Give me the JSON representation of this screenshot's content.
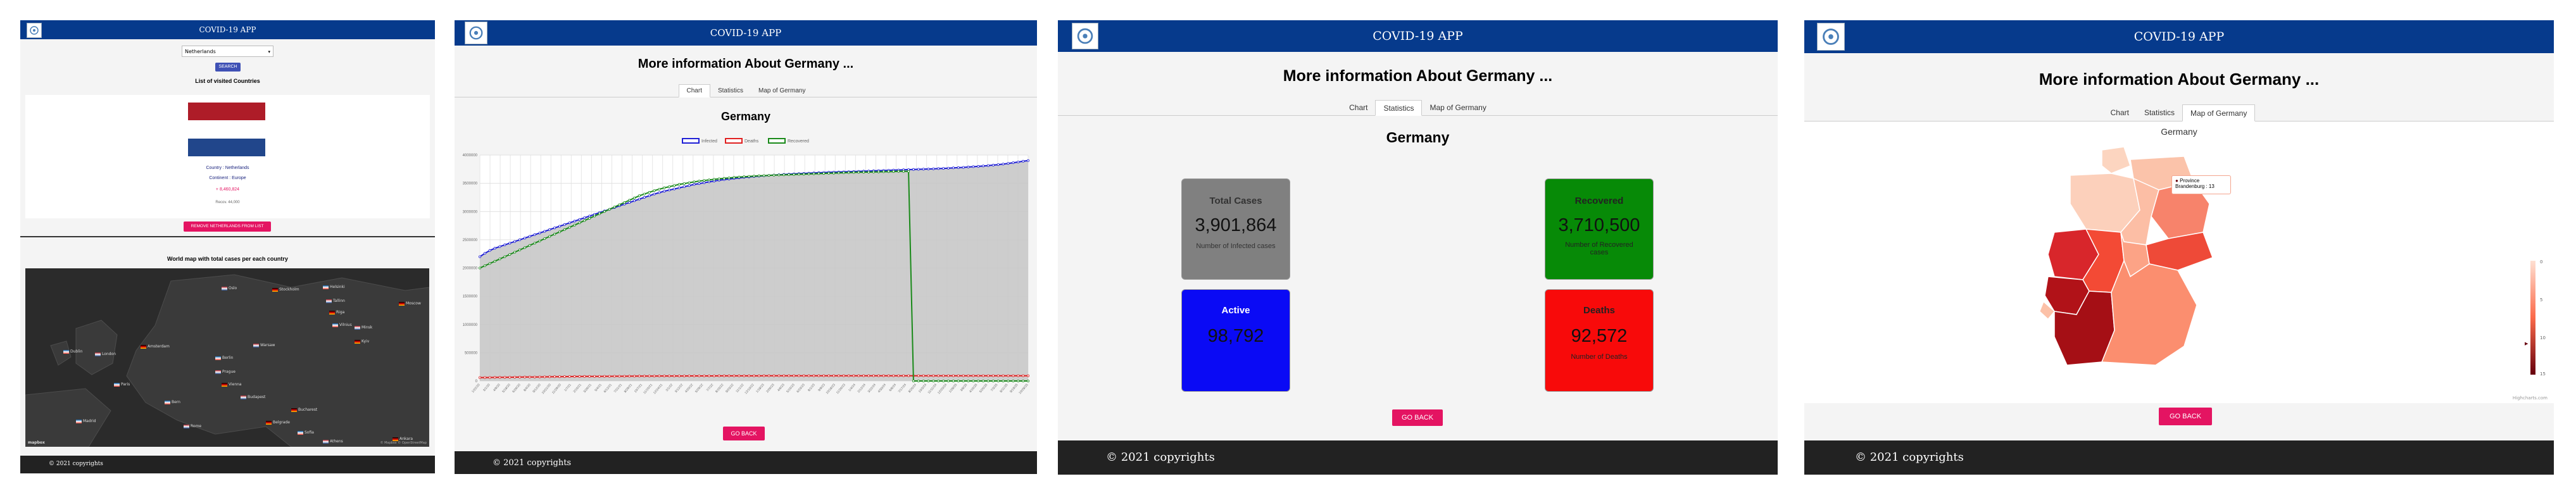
{
  "app": {
    "title": "COVID-19 APP",
    "footer": "© 2021 copyrights",
    "go_back": "GO BACK"
  },
  "p1": {
    "select_value": "Netherlands",
    "search_button": "SEARCH",
    "visited_heading": "List of visited Countries",
    "country": "Country : Netherlands",
    "continent": "Continent : Europe",
    "cases": "+ 8,460,824",
    "recovered_small": "Recov. 44,000",
    "remove_button": "REMOVE NETHERLANDS FROM LIST",
    "map_heading": "World map with total cases per each country",
    "map_cities": [
      "Oslo",
      "Stockholm",
      "Helsinki",
      "Tallinn",
      "Riga",
      "Vilnius",
      "Minsk",
      "Moscow",
      "Dublin",
      "London",
      "Amsterdam",
      "Berlin",
      "Warsaw",
      "Kyiv",
      "Paris",
      "Prague",
      "Vienna",
      "Bern",
      "Budapest",
      "Bucharest",
      "Madrid",
      "Rome",
      "Belgrade",
      "Sofia",
      "Athens",
      "Ankara"
    ],
    "map_credit": "© Mapbox © OpenStreetMap",
    "map_logo": "mapbox",
    "flag_colors": [
      "#ae1c28",
      "#ffffff",
      "#21468b"
    ]
  },
  "tabs": [
    "Chart",
    "Statistics",
    "Map of Germany"
  ],
  "detail_title": "More information About Germany ...",
  "country_name": "Germany",
  "chart_data": {
    "type": "line",
    "title": "Germany",
    "series": [
      {
        "name": "Infected",
        "color": "#1f1fd6",
        "values": [
          2200000,
          2260000,
          2310000,
          2350000,
          2380000,
          2410000,
          2440000,
          2470000,
          2500000,
          2530000,
          2560000,
          2590000,
          2620000,
          2650000,
          2680000,
          2710000,
          2740000,
          2770000,
          2800000,
          2830000,
          2860000,
          2890000,
          2920000,
          2950000,
          2980000,
          3010000,
          3040000,
          3070000,
          3100000,
          3130000,
          3160000,
          3190000,
          3220000,
          3250000,
          3280000,
          3310000,
          3335000,
          3360000,
          3380000,
          3400000,
          3420000,
          3440000,
          3460000,
          3480000,
          3495000,
          3510000,
          3525000,
          3540000,
          3555000,
          3565000,
          3575000,
          3585000,
          3595000,
          3605000,
          3612000,
          3620000,
          3627000,
          3634000,
          3640000,
          3646000,
          3652000,
          3657000,
          3662000,
          3667000,
          3671000,
          3675000,
          3679000,
          3683000,
          3687000,
          3691000,
          3694000,
          3697000,
          3700000,
          3703000,
          3706000,
          3709000,
          3712000,
          3715000,
          3718000,
          3721000,
          3724000,
          3727000,
          3730000,
          3733000,
          3736000,
          3739000,
          3742000,
          3745000,
          3748000,
          3751000,
          3754000,
          3757000,
          3760000,
          3764000,
          3768000,
          3772000,
          3777000,
          3782000,
          3788000,
          3794000,
          3800000,
          3807000,
          3814000,
          3822000,
          3831000,
          3841000,
          3852000,
          3864000,
          3877000,
          3890000,
          3901864
        ]
      },
      {
        "name": "Deaths",
        "color": "#e02020",
        "values": [
          60000,
          61000,
          62000,
          63000,
          64000,
          65000,
          66000,
          67000,
          68000,
          69000,
          70000,
          71000,
          72000,
          73000,
          74000,
          75000,
          76000,
          77000,
          78000,
          79000,
          80000,
          80500,
          81000,
          81500,
          82000,
          82500,
          83000,
          83500,
          84000,
          84500,
          85000,
          85500,
          86000,
          86500,
          87000,
          87500,
          88000,
          88200,
          88400,
          88600,
          88800,
          89000,
          89200,
          89400,
          89600,
          89800,
          90000,
          90150,
          90300,
          90450,
          90600,
          90750,
          90900,
          91000,
          91100,
          91200,
          91300,
          91400,
          91450,
          91500,
          91550,
          91600,
          91650,
          91700,
          91750,
          91800,
          91850,
          91900,
          91950,
          92000,
          92040,
          92080,
          92120,
          92160,
          92200,
          92230,
          92260,
          92290,
          92320,
          92350,
          92375,
          92400,
          92420,
          92440,
          92460,
          92480,
          92495,
          92510,
          92525,
          92540,
          92550,
          92555,
          92560,
          92562,
          92564,
          92566,
          92567,
          92568,
          92569,
          92570,
          92570,
          92571,
          92571,
          92571,
          92572,
          92572,
          92572,
          92572,
          92572,
          92572,
          92572
        ]
      },
      {
        "name": "Recovered",
        "color": "#1a8a1a",
        "values": [
          2000000,
          2040000,
          2080000,
          2120000,
          2160000,
          2200000,
          2240000,
          2280000,
          2320000,
          2360000,
          2400000,
          2440000,
          2480000,
          2520000,
          2560000,
          2600000,
          2640000,
          2680000,
          2720000,
          2760000,
          2800000,
          2840000,
          2880000,
          2920000,
          2960000,
          3000000,
          3040000,
          3080000,
          3120000,
          3160000,
          3200000,
          3240000,
          3280000,
          3310000,
          3340000,
          3370000,
          3395000,
          3420000,
          3440000,
          3460000,
          3480000,
          3495000,
          3510000,
          3525000,
          3540000,
          3550000,
          3560000,
          3570000,
          3580000,
          3588000,
          3596000,
          3603000,
          3610000,
          3616000,
          3622000,
          3627000,
          3632000,
          3636000,
          3640000,
          3644000,
          3647000,
          3650000,
          3653000,
          3656000,
          3659000,
          3662000,
          3665000,
          3668000,
          3671000,
          3674000,
          3677000,
          3680000,
          3683000,
          3686000,
          3689000,
          3692000,
          3694000,
          3696000,
          3698000,
          3700000,
          3702000,
          3704000,
          3706000,
          3708000,
          3710500,
          3710500,
          3710500,
          0,
          0,
          0,
          0,
          0,
          0,
          0,
          0,
          0,
          0,
          0,
          0,
          0,
          0,
          0,
          0,
          0,
          0,
          0,
          0,
          0,
          0,
          0,
          0
        ]
      }
    ],
    "y_ticks": [
      "4000000",
      "3500000",
      "3000000",
      "2500000",
      "2000000",
      "1500000",
      "1000000",
      "500000",
      "0"
    ],
    "ylim": [
      0,
      4000000
    ],
    "x_labels": [
      "1/22/20",
      "3/1/20",
      "4/9/20",
      "5/18/20",
      "6/26/20",
      "8/4/20",
      "9/12/20",
      "10/21/20",
      "11/29/20",
      "1/7/21",
      "2/15/21",
      "3/26/21",
      "5/4/21",
      "6/12/21",
      "7/21/21",
      "8/29/21",
      "10/7/21",
      "11/15/21",
      "12/24/21",
      "2/1/22",
      "3/12/22",
      "4/20/22",
      "5/29/22",
      "7/7/22",
      "8/15/22",
      "9/23/22",
      "11/1/22",
      "12/10/22",
      "1/18/23",
      "2/26/23",
      "4/6/23",
      "5/15/23",
      "6/23/23",
      "8/1/23",
      "9/9/23",
      "10/18/23",
      "11/26/23",
      "1/4/24",
      "2/12/24",
      "3/22/24",
      "4/30/24",
      "6/8/24",
      "7/17/24",
      "8/25/24",
      "10/3/24",
      "11/11/24",
      "12/20/24",
      "1/28/25",
      "3/8/25",
      "4/16/25",
      "5/25/25",
      "7/3/25",
      "8/11/25",
      "9/19/25",
      "10/28/25"
    ],
    "grid": true,
    "legend_position": "top"
  },
  "stats": {
    "total": {
      "title": "Total Cases",
      "value": "3,901,864",
      "sub": "Number of Infected cases",
      "color": "#808080"
    },
    "recovered": {
      "title": "Recovered",
      "value": "3,710,500",
      "sub": "Number of Recovered cases",
      "color": "#078a07"
    },
    "active": {
      "title": "Active",
      "value": "98,792",
      "sub": "",
      "color": "#0a0af5"
    },
    "deaths": {
      "title": "Deaths",
      "value": "92,572",
      "sub": "Number of Deaths",
      "color": "#f80a0a"
    }
  },
  "map": {
    "title": "Germany",
    "tooltip_label": "Province",
    "tooltip_value": "Brandenburg : 13",
    "legend_ticks": [
      "0",
      "5",
      "10",
      "15"
    ],
    "credit": "Highcharts.com"
  }
}
